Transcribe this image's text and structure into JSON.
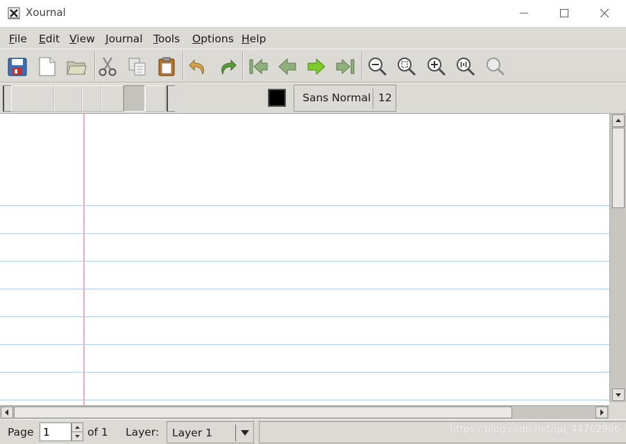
{
  "window": {
    "title": "Xournal"
  },
  "menubar": {
    "items": [
      {
        "label": "File"
      },
      {
        "label": "Edit"
      },
      {
        "label": "View"
      },
      {
        "label": "Journal"
      },
      {
        "label": "Tools"
      },
      {
        "label": "Options"
      },
      {
        "label": "Help"
      }
    ]
  },
  "toolbar": {
    "buttons": [
      "save-icon",
      "new-page-icon",
      "open-folder-icon",
      "cut-icon",
      "copy-icon",
      "paste-icon",
      "undo-icon",
      "redo-icon",
      "first-page-icon",
      "previous-page-icon",
      "next-page-icon",
      "last-page-icon",
      "zoom-out-icon",
      "zoom-fit-icon",
      "zoom-in-icon",
      "zoom-100-icon",
      "zoom-set-icon"
    ]
  },
  "pen_toolbar": {
    "color": "#000000",
    "font_name": "Sans Normal",
    "font_size": "12"
  },
  "paper": {
    "ruling_color": "#a8cff2",
    "margin_color": "#f5a6cc"
  },
  "status": {
    "page_label": "Page",
    "page_value": "1",
    "of_label": "of 1",
    "layer_label": "Layer:",
    "layer_value": "Layer 1",
    "message": ""
  },
  "watermark": "https://blog.csdn.net/qq_44762986"
}
